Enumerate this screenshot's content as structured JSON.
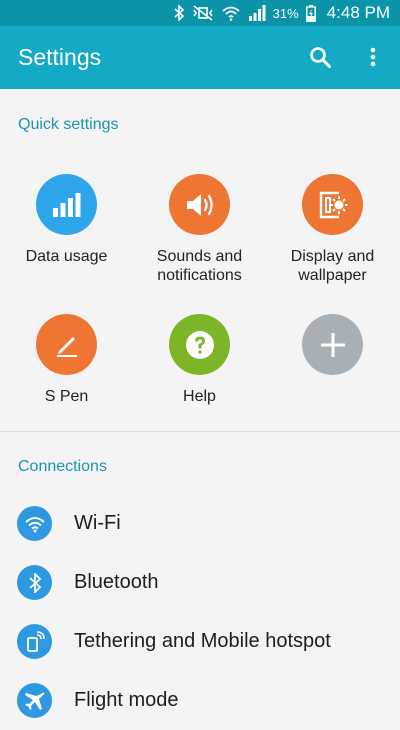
{
  "status_bar": {
    "battery": "31%",
    "time": "4:48 PM"
  },
  "app_bar": {
    "title": "Settings"
  },
  "quick_settings": {
    "header": "Quick settings",
    "tiles": [
      {
        "label": "Data usage",
        "icon": "bar-chart-icon",
        "color": "#2ea5ea"
      },
      {
        "label": "Sounds and notifications",
        "icon": "speaker-icon",
        "color": "#ee7632"
      },
      {
        "label": "Display and wallpaper",
        "icon": "display-wallpaper-icon",
        "color": "#ee7632"
      },
      {
        "label": "S Pen",
        "icon": "pen-icon",
        "color": "#ee7632"
      },
      {
        "label": "Help",
        "icon": "question-icon",
        "color": "#7cb527"
      },
      {
        "label": "",
        "icon": "plus-icon",
        "color": "#a8b0b6"
      }
    ]
  },
  "connections": {
    "header": "Connections",
    "items": [
      {
        "label": "Wi-Fi",
        "icon": "wifi-icon"
      },
      {
        "label": "Bluetooth",
        "icon": "bluetooth-icon"
      },
      {
        "label": "Tethering and Mobile hotspot",
        "icon": "tethering-icon"
      },
      {
        "label": "Flight mode",
        "icon": "airplane-icon"
      }
    ],
    "icon_color": "#2e99e0"
  }
}
